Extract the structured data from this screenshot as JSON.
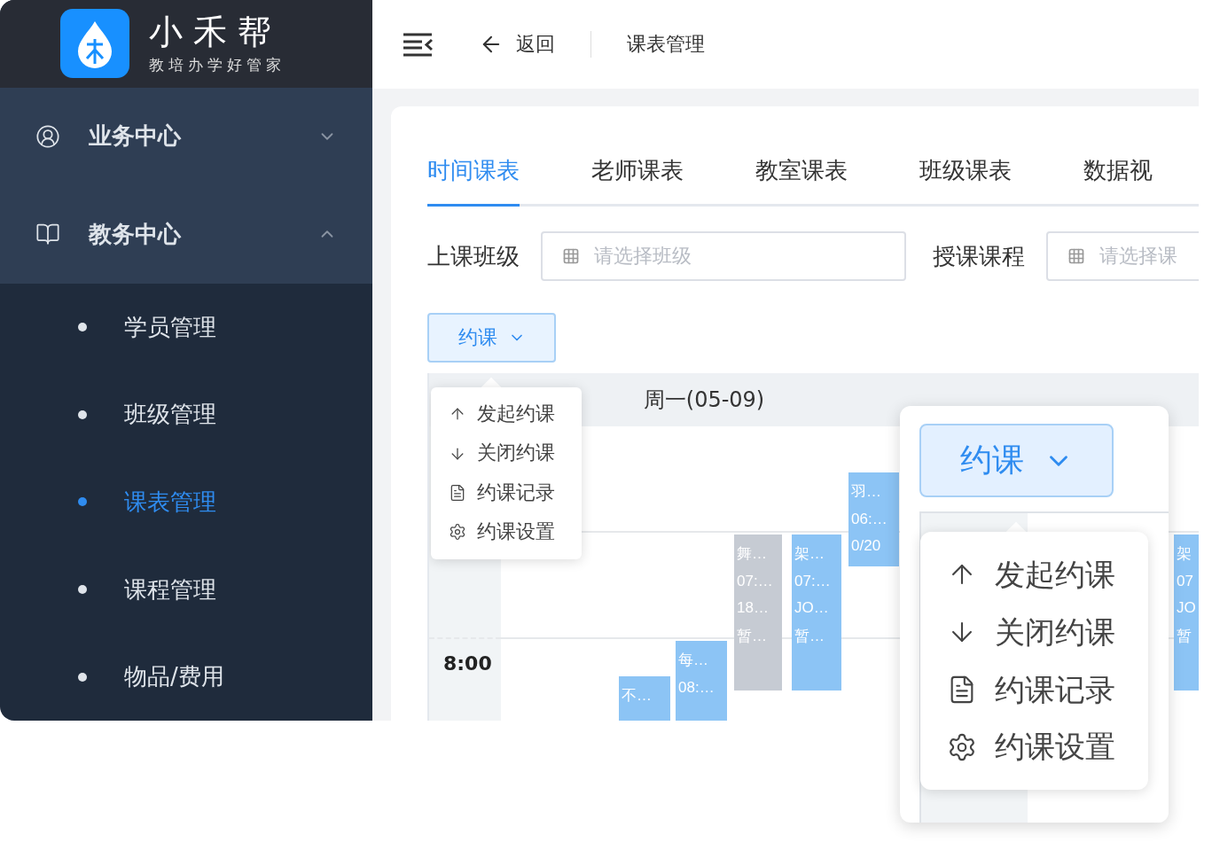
{
  "sidebar": {
    "logo": {
      "name": "小禾帮",
      "slogan": "教培办学好管家"
    },
    "groups": [
      {
        "label": "业务中心",
        "expanded": false
      },
      {
        "label": "教务中心",
        "expanded": true,
        "children": [
          {
            "label": "学员管理",
            "selected": false
          },
          {
            "label": "班级管理",
            "selected": false
          },
          {
            "label": "课表管理",
            "selected": true
          },
          {
            "label": "课程管理",
            "selected": false
          },
          {
            "label": "物品/费用",
            "selected": false
          }
        ]
      }
    ]
  },
  "header": {
    "back": "返回",
    "breadcrumb": "课表管理"
  },
  "tabs": [
    {
      "label": "时间课表",
      "selected": true
    },
    {
      "label": "老师课表",
      "selected": false
    },
    {
      "label": "教室课表",
      "selected": false
    },
    {
      "label": "班级课表",
      "selected": false
    },
    {
      "label": "数据视",
      "selected": false
    }
  ],
  "filters": [
    {
      "label": "上课班级",
      "placeholder": "请选择班级"
    },
    {
      "label": "授课课程",
      "placeholder": "请选择课"
    }
  ],
  "booking_button": "约课",
  "booking_menu": [
    {
      "label": "发起约课",
      "kind": "up"
    },
    {
      "label": "关闭约课",
      "kind": "down"
    },
    {
      "label": "约课记录",
      "kind": "record"
    },
    {
      "label": "约课设置",
      "kind": "settings"
    }
  ],
  "calendar": {
    "day_header": "周一(05-09)",
    "time_label": "8:00",
    "events": [
      {
        "lines": [
          "羽…",
          "06:…",
          "0/20"
        ],
        "color": "#8cc4f5"
      },
      {
        "lines": [
          "舞…",
          "07:…",
          "18…",
          "暂…"
        ],
        "color": "#c6cbd3"
      },
      {
        "lines": [
          "架…",
          "07:…",
          "JO…",
          "暂…"
        ],
        "color": "#8cc4f5"
      },
      {
        "lines": [
          "每…",
          "08:…"
        ],
        "color": "#8cc4f5"
      },
      {
        "lines": [
          "不…"
        ],
        "color": "#8cc4f5"
      },
      {
        "lines": [
          "架",
          "07",
          "JO",
          "暂"
        ],
        "color": "#8cc4f5"
      }
    ]
  },
  "zoom_callout": {
    "button": "约课",
    "menu": [
      {
        "label": "发起约课",
        "kind": "up"
      },
      {
        "label": "关闭约课",
        "kind": "down"
      },
      {
        "label": "约课记录",
        "kind": "record"
      },
      {
        "label": "约课设置",
        "kind": "settings"
      }
    ]
  }
}
